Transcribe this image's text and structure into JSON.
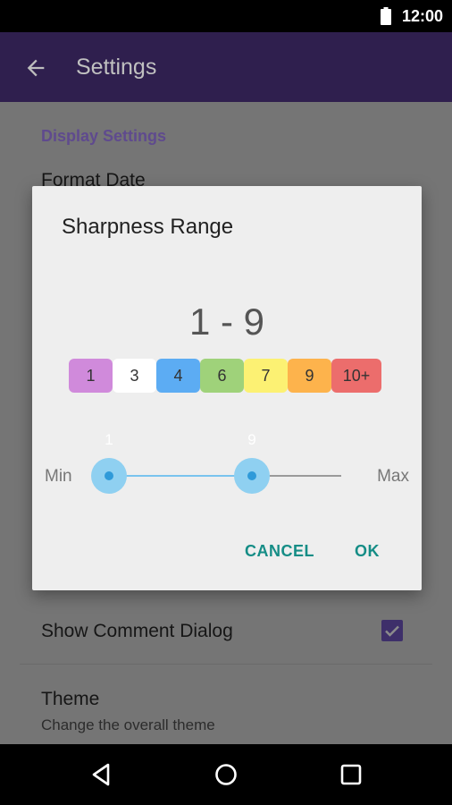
{
  "status_bar": {
    "time": "12:00",
    "battery_icon": "battery-icon"
  },
  "app_bar": {
    "title": "Settings",
    "back_icon": "arrow-back-icon"
  },
  "settings": {
    "section_header": "Display Settings",
    "format_date": "Format Date",
    "show_comment_dialog": {
      "label": "Show Comment Dialog",
      "checked": true
    },
    "theme": {
      "title": "Theme",
      "subtitle": "Change the overall theme"
    }
  },
  "dialog": {
    "title": "Sharpness Range",
    "range_display": "1 - 9",
    "chips": [
      {
        "label": "1",
        "color": "#d08adb"
      },
      {
        "label": "3",
        "color": "#ffffff"
      },
      {
        "label": "4",
        "color": "#5cacf3"
      },
      {
        "label": "6",
        "color": "#9fd27a"
      },
      {
        "label": "7",
        "color": "#fcf173"
      },
      {
        "label": "9",
        "color": "#fdb34c"
      },
      {
        "label": "10+",
        "color": "#ec6d6c"
      }
    ],
    "slider": {
      "min_label": "Min",
      "max_label": "Max",
      "low_value": "1",
      "high_value": "9",
      "accent_color": "#79c3ee"
    },
    "cancel_label": "CANCEL",
    "ok_label": "OK",
    "button_color": "#158d86"
  },
  "nav_bar": {
    "back_icon": "nav-back-icon",
    "home_icon": "nav-home-icon",
    "recents_icon": "nav-recents-icon"
  }
}
